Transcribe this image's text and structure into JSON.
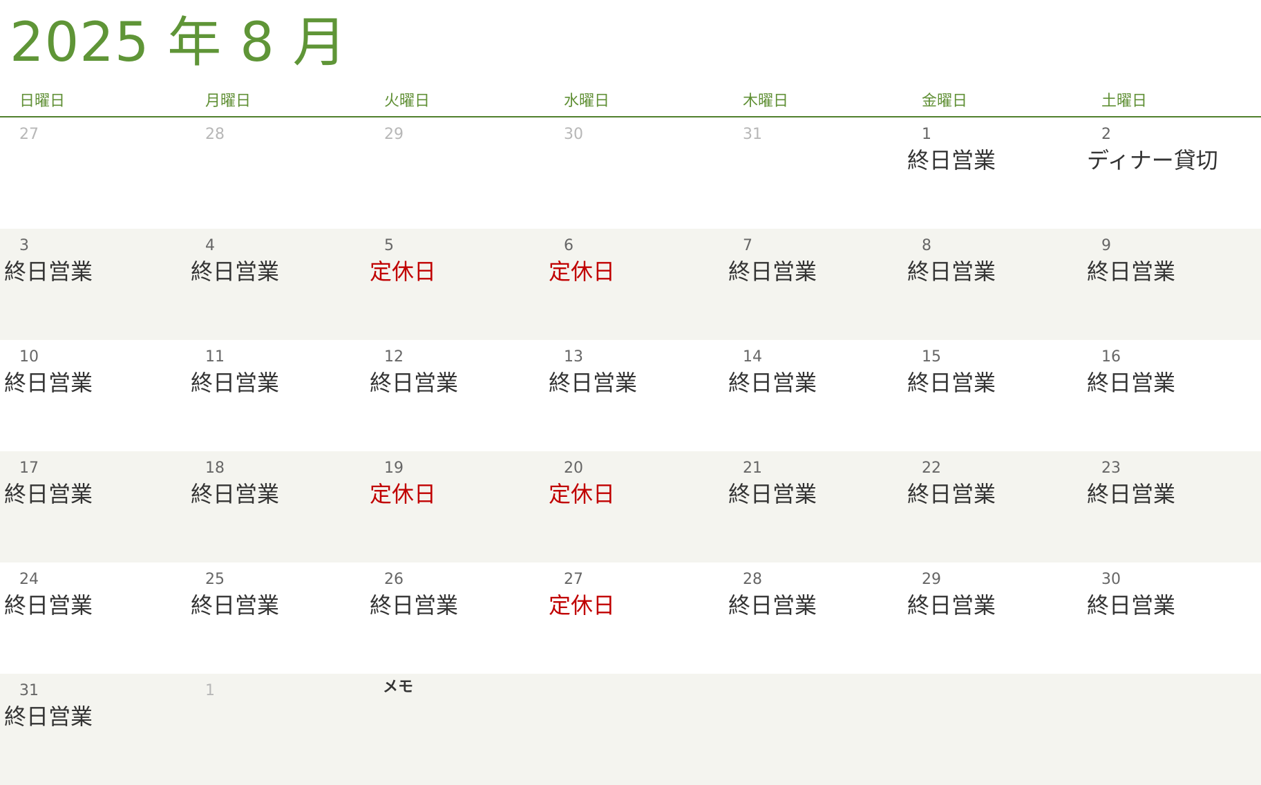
{
  "title": "2025 年 8 月",
  "weekdays": [
    "日曜日",
    "月曜日",
    "火曜日",
    "水曜日",
    "木曜日",
    "金曜日",
    "土曜日"
  ],
  "weeks": [
    [
      {
        "day": "27",
        "muted": true,
        "event": ""
      },
      {
        "day": "28",
        "muted": true,
        "event": ""
      },
      {
        "day": "29",
        "muted": true,
        "event": ""
      },
      {
        "day": "30",
        "muted": true,
        "event": ""
      },
      {
        "day": "31",
        "muted": true,
        "event": ""
      },
      {
        "day": "1",
        "muted": false,
        "event": "終日営業"
      },
      {
        "day": "2",
        "muted": false,
        "event": "ディナー貸切"
      }
    ],
    [
      {
        "day": "3",
        "muted": false,
        "event": "終日営業"
      },
      {
        "day": "4",
        "muted": false,
        "event": "終日営業"
      },
      {
        "day": "5",
        "muted": false,
        "event": "定休日",
        "holiday": true
      },
      {
        "day": "6",
        "muted": false,
        "event": "定休日",
        "holiday": true
      },
      {
        "day": "7",
        "muted": false,
        "event": "終日営業"
      },
      {
        "day": "8",
        "muted": false,
        "event": "終日営業"
      },
      {
        "day": "9",
        "muted": false,
        "event": "終日営業"
      }
    ],
    [
      {
        "day": "10",
        "muted": false,
        "event": "終日営業"
      },
      {
        "day": "11",
        "muted": false,
        "event": "終日営業"
      },
      {
        "day": "12",
        "muted": false,
        "event": "終日営業"
      },
      {
        "day": "13",
        "muted": false,
        "event": "終日営業"
      },
      {
        "day": "14",
        "muted": false,
        "event": "終日営業"
      },
      {
        "day": "15",
        "muted": false,
        "event": "終日営業"
      },
      {
        "day": "16",
        "muted": false,
        "event": "終日営業"
      }
    ],
    [
      {
        "day": "17",
        "muted": false,
        "event": "終日営業"
      },
      {
        "day": "18",
        "muted": false,
        "event": "終日営業"
      },
      {
        "day": "19",
        "muted": false,
        "event": "定休日",
        "holiday": true
      },
      {
        "day": "20",
        "muted": false,
        "event": "定休日",
        "holiday": true
      },
      {
        "day": "21",
        "muted": false,
        "event": "終日営業"
      },
      {
        "day": "22",
        "muted": false,
        "event": "終日営業"
      },
      {
        "day": "23",
        "muted": false,
        "event": "終日営業"
      }
    ],
    [
      {
        "day": "24",
        "muted": false,
        "event": "終日営業"
      },
      {
        "day": "25",
        "muted": false,
        "event": "終日営業"
      },
      {
        "day": "26",
        "muted": false,
        "event": "終日営業"
      },
      {
        "day": "27",
        "muted": false,
        "event": "定休日",
        "holiday": true
      },
      {
        "day": "28",
        "muted": false,
        "event": "終日営業"
      },
      {
        "day": "29",
        "muted": false,
        "event": "終日営業"
      },
      {
        "day": "30",
        "muted": false,
        "event": "終日営業"
      }
    ],
    [
      {
        "day": "31",
        "muted": false,
        "event": "終日営業"
      },
      {
        "day": "1",
        "muted": true,
        "event": ""
      }
    ]
  ],
  "memo_label": "メモ",
  "colors": {
    "title": "#5f9537",
    "weekday": "#5f8f34",
    "header_rule": "#4f7f2c",
    "day_number": "#666666",
    "day_number_muted": "#b7b7b7",
    "event": "#333333",
    "holiday": "#c00000",
    "row_shade": "#f4f4ef",
    "row_plain": "#ffffff",
    "memo": "#333333"
  }
}
